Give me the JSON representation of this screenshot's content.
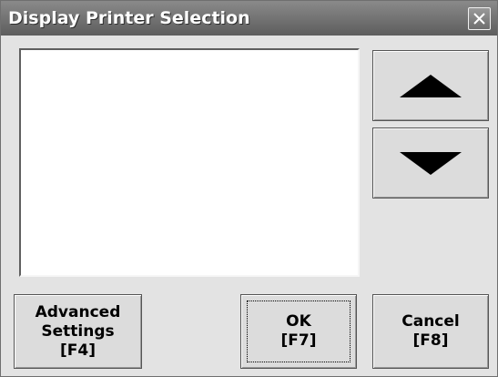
{
  "dialog": {
    "title": "Display Printer Selection",
    "close_icon": "close-icon"
  },
  "printer_list": {
    "items": []
  },
  "scroll_buttons": {
    "up_icon": "triangle-up-icon",
    "down_icon": "triangle-down-icon"
  },
  "buttons": {
    "advanced_label": "Advanced\nSettings\n[F4]",
    "ok_label": "OK\n[F7]",
    "cancel_label": "Cancel\n[F8]"
  },
  "colors": {
    "titlebar": "#6e6e6e",
    "dialog_background": "#e3e3e3",
    "list_background": "#ffffff"
  }
}
